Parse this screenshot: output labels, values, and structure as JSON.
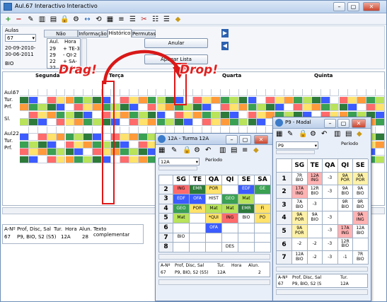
{
  "window": {
    "title": "Aul.67 Interactivo Interactivo",
    "min": "–",
    "max": "▢",
    "close": "✕"
  },
  "toolbar": {
    "icons": [
      "+",
      "−",
      "✎",
      "▥",
      "▤",
      "🔒",
      "⚙",
      "↔",
      "⟲",
      "▦",
      "≡",
      "☰",
      "✂",
      "☷",
      "☰",
      "◆"
    ]
  },
  "top_panel": {
    "aulas_label": "Aulas",
    "aula_value": "67",
    "dates": "20-09-2010-\n30-06-2011",
    "bio": "BIO",
    "tabs": [
      "Não colocadas",
      "Informação",
      "Histórico",
      "Permutas"
    ],
    "active_tab": "Histórico",
    "list_head": [
      "Aul.",
      "Hora"
    ],
    "list_rows": [
      [
        "29",
        "+ TE-3"
      ],
      [
        "29",
        "- QI-2"
      ],
      [
        "22",
        "+ SA-5"
      ],
      [
        "22",
        "TE 2"
      ]
    ],
    "anular": "Anular",
    "apagar": "Apagar Lista"
  },
  "annotations": {
    "drag": "Drag!",
    "drop": "Drop!"
  },
  "grid": {
    "days": [
      "Segunda",
      "Terça",
      "Quarta",
      "Quinta"
    ],
    "row_labels": [
      "Aul.",
      "Tur.",
      "Prf.",
      "Sl.",
      "",
      "Aul.",
      "Tur.",
      "Prf."
    ],
    "aul_a": "67",
    "aul_b": "22"
  },
  "bottom": {
    "head": [
      "A-Nº",
      "Prof, Disc, Sal",
      "Tur.",
      "Hora",
      "Alun.",
      "Texto complementar"
    ],
    "row": [
      "67",
      "P9, BIO, S2 (S5)",
      "12A",
      "",
      "28",
      ""
    ]
  },
  "win12a": {
    "title": "12A - Turma 12A",
    "combo": "12A",
    "periodo": "Período",
    "cols": [
      "SG",
      "TE",
      "QA",
      "QI",
      "SE",
      "SA"
    ],
    "rows": [
      [
        "2",
        [
          "ING",
          "EMR",
          "POR",
          "",
          "EDF",
          "GE"
        ]
      ],
      [
        "3",
        [
          "EDF",
          "OFA",
          "HIST",
          "GEO",
          "Mat",
          ""
        ]
      ],
      [
        "4",
        [
          "GEO",
          "POR",
          "Mat",
          "Mat",
          "EMR",
          "Fi"
        ]
      ],
      [
        "5",
        [
          "Mat",
          "",
          "*QUI",
          "ING",
          "BIO",
          "PO"
        ]
      ],
      [
        "6",
        [
          "",
          "",
          "OFA",
          "",
          "",
          ""
        ]
      ],
      [
        "7",
        [
          "BIO",
          "",
          "",
          "",
          "",
          ""
        ]
      ],
      [
        "8",
        [
          "",
          "",
          "",
          "DES",
          "",
          ""
        ]
      ]
    ],
    "bottom_head": [
      "A-Nº",
      "Prof, Disc, Sal",
      "Tur.",
      "Hora",
      "Alun."
    ],
    "bottom_row": [
      "67",
      "P9, BIO, S2 (S5)",
      "12A",
      "",
      "2"
    ]
  },
  "winp9": {
    "title": "P9 - Madal",
    "combo": "P9",
    "periodo": "Período",
    "cols": [
      "SG",
      "TE",
      "QA",
      "QI",
      "SE"
    ],
    "rows": [
      [
        "1",
        [
          "7R\nBIO",
          "12A\nING",
          "-3",
          "9A\nPOR",
          "9A\nPOR"
        ]
      ],
      [
        "2",
        [
          "17A\nING",
          "12R\nBIO",
          "-3",
          "9A\nBIO",
          "9A\nBIO"
        ]
      ],
      [
        "3",
        [
          "7A\nBIO",
          "-3",
          "",
          "9R\nBIO",
          "9R\nBIO"
        ]
      ],
      [
        "4",
        [
          "9A\nPOR",
          "9A\nBIO",
          "-3",
          "",
          "9A\nING"
        ]
      ],
      [
        "5",
        [
          "9A\nPOR",
          "",
          "-3",
          "17A\nING",
          "12A\nBIO"
        ]
      ],
      [
        "6",
        [
          "-2",
          "-2",
          "-3",
          "12R\nBIO",
          ""
        ]
      ],
      [
        "7",
        [
          "12A\nBIO",
          "-2",
          "-3",
          "-1",
          "7R\nBIO"
        ]
      ]
    ],
    "bottom_head": [
      "A-Nº",
      "Prof, Disc, Sal",
      "Tur."
    ],
    "bottom_row": [
      "67",
      "P9, BIO, S2 (S",
      "12A"
    ]
  }
}
